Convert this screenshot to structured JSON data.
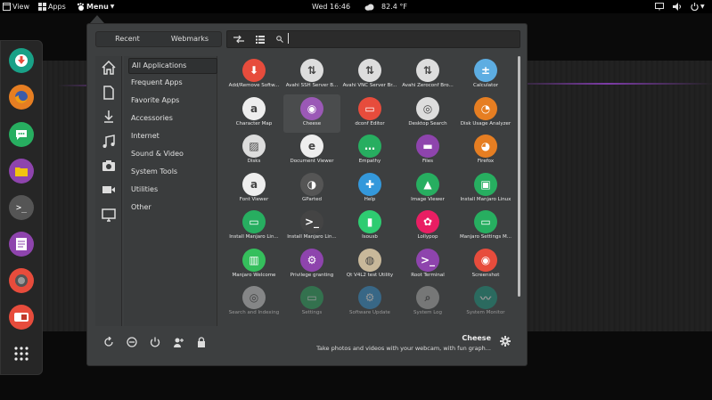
{
  "topbar": {
    "view_label": "View",
    "apps_label": "Apps",
    "menu_label": "Menu",
    "clock": "Wed 16:46",
    "temperature": "82.4 °F"
  },
  "menu": {
    "tabs": [
      "Recent",
      "Webmarks"
    ],
    "search_value": "",
    "categories": [
      "All Applications",
      "Frequent Apps",
      "Favorite Apps",
      "Accessories",
      "Internet",
      "Sound & Video",
      "System Tools",
      "Utilities",
      "Other"
    ],
    "apps": [
      {
        "label": "Add/Remove Softw...",
        "icon": "package-download-icon",
        "color": "#e74c3c"
      },
      {
        "label": "Avahi SSH Server B...",
        "icon": "network-arrows-icon",
        "color": "#dddddd"
      },
      {
        "label": "Avahi VNC Server Br...",
        "icon": "network-arrows-icon",
        "color": "#dddddd"
      },
      {
        "label": "Avahi Zeroconf Bro...",
        "icon": "network-arrows-icon",
        "color": "#dddddd"
      },
      {
        "label": "Calculator",
        "icon": "calculator-icon",
        "color": "#5dade2"
      },
      {
        "label": "Character Map",
        "icon": "character-map-icon",
        "color": "#eeeeee"
      },
      {
        "label": "Cheese",
        "icon": "camera-icon",
        "color": "#9b59b6"
      },
      {
        "label": "dconf Editor",
        "icon": "dconf-icon",
        "color": "#e74c3c"
      },
      {
        "label": "Desktop Search",
        "icon": "search-target-icon",
        "color": "#dddddd"
      },
      {
        "label": "Disk Usage Analyzer",
        "icon": "pie-chart-icon",
        "color": "#e67e22"
      },
      {
        "label": "Disks",
        "icon": "disk-icon",
        "color": "#dddddd"
      },
      {
        "label": "Document Viewer",
        "icon": "document-viewer-icon",
        "color": "#eeeeee"
      },
      {
        "label": "Empathy",
        "icon": "chat-bubble-icon",
        "color": "#27ae60"
      },
      {
        "label": "Files",
        "icon": "folder-icon",
        "color": "#8e44ad"
      },
      {
        "label": "Firefox",
        "icon": "firefox-icon",
        "color": "#e67e22"
      },
      {
        "label": "Font Viewer",
        "icon": "font-viewer-icon",
        "color": "#eeeeee"
      },
      {
        "label": "GParted",
        "icon": "partition-icon",
        "color": "#555555"
      },
      {
        "label": "Help",
        "icon": "lifebuoy-icon",
        "color": "#3498db"
      },
      {
        "label": "Image Viewer",
        "icon": "image-viewer-icon",
        "color": "#27ae60"
      },
      {
        "label": "Install Manjaro Linux",
        "icon": "installer-box-icon",
        "color": "#27ae60"
      },
      {
        "label": "Install Manjaro Lin...",
        "icon": "settings-toggle-icon",
        "color": "#27ae60"
      },
      {
        "label": "Install Manjaro Lin...",
        "icon": "terminal-icon",
        "color": "#444444"
      },
      {
        "label": "Isousb",
        "icon": "usb-icon",
        "color": "#2ecc71"
      },
      {
        "label": "Lollypop",
        "icon": "lollipop-icon",
        "color": "#e91e63"
      },
      {
        "label": "Manjaro Settings M...",
        "icon": "settings-toggle-icon",
        "color": "#27ae60"
      },
      {
        "label": "Manjaro Welcome",
        "icon": "manjaro-logo-icon",
        "color": "#35bf5c"
      },
      {
        "label": "Privilege granting",
        "icon": "gear-icon",
        "color": "#8e44ad"
      },
      {
        "label": "Qt V4L2 test Utility",
        "icon": "webcam-icon",
        "color": "#c8b89a"
      },
      {
        "label": "Root Terminal",
        "icon": "root-terminal-icon",
        "color": "#8e44ad"
      },
      {
        "label": "Screenshot",
        "icon": "screenshot-icon",
        "color": "#e74c3c"
      },
      {
        "label": "Search and Indexing",
        "icon": "search-target-icon",
        "color": "#dddddd"
      },
      {
        "label": "Settings",
        "icon": "settings-toggle-icon",
        "color": "#27ae60"
      },
      {
        "label": "Software Update",
        "icon": "software-update-icon",
        "color": "#3498db"
      },
      {
        "label": "System Log",
        "icon": "magnifier-icon",
        "color": "#bbbbbb"
      },
      {
        "label": "System Monitor",
        "icon": "system-monitor-icon",
        "color": "#16a085"
      }
    ],
    "description": {
      "title": "Cheese",
      "text": "Take photos and videos with your webcam, with fun graph..."
    }
  }
}
